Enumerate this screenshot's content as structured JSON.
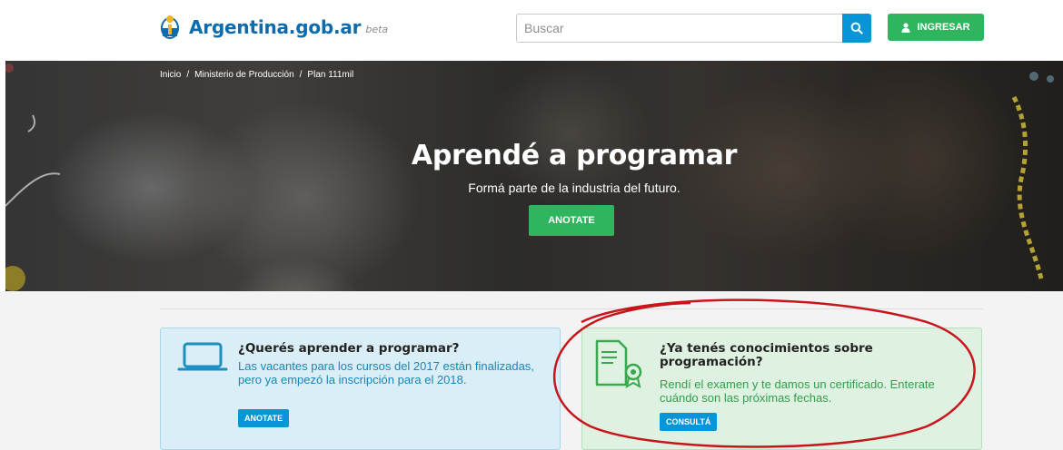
{
  "header": {
    "logo_text": "Argentina.gob.ar",
    "logo_beta": "beta",
    "search_placeholder": "Buscar",
    "login_label": "INGRESAR"
  },
  "breadcrumb": {
    "items": [
      "Inicio",
      "/",
      "Ministerio de Producción",
      "/",
      "Plan 111mil"
    ]
  },
  "hero": {
    "title": "Aprendé a programar",
    "subtitle": "Formá parte de la industria del futuro.",
    "button_label": "ANOTATE"
  },
  "cards": [
    {
      "title": "¿Querés aprender a programar?",
      "text": "Las vacantes para los cursos del 2017 están finalizadas, pero ya empezó la inscripción para el 2018.",
      "button_label": "ANOTATE",
      "icon": "laptop-icon"
    },
    {
      "title": "¿Ya tenés conocimientos sobre programación?",
      "text": "Rendí el examen y te damos un certificado. Enterate cuándo son las próximas fechas.",
      "button_label": "CONSULTÁ",
      "icon": "certificate-icon"
    }
  ],
  "colors": {
    "brand_blue": "#0d6aab",
    "action_blue": "#0695d6",
    "action_green": "#2eb55e",
    "annotation_red": "#c8151b"
  }
}
